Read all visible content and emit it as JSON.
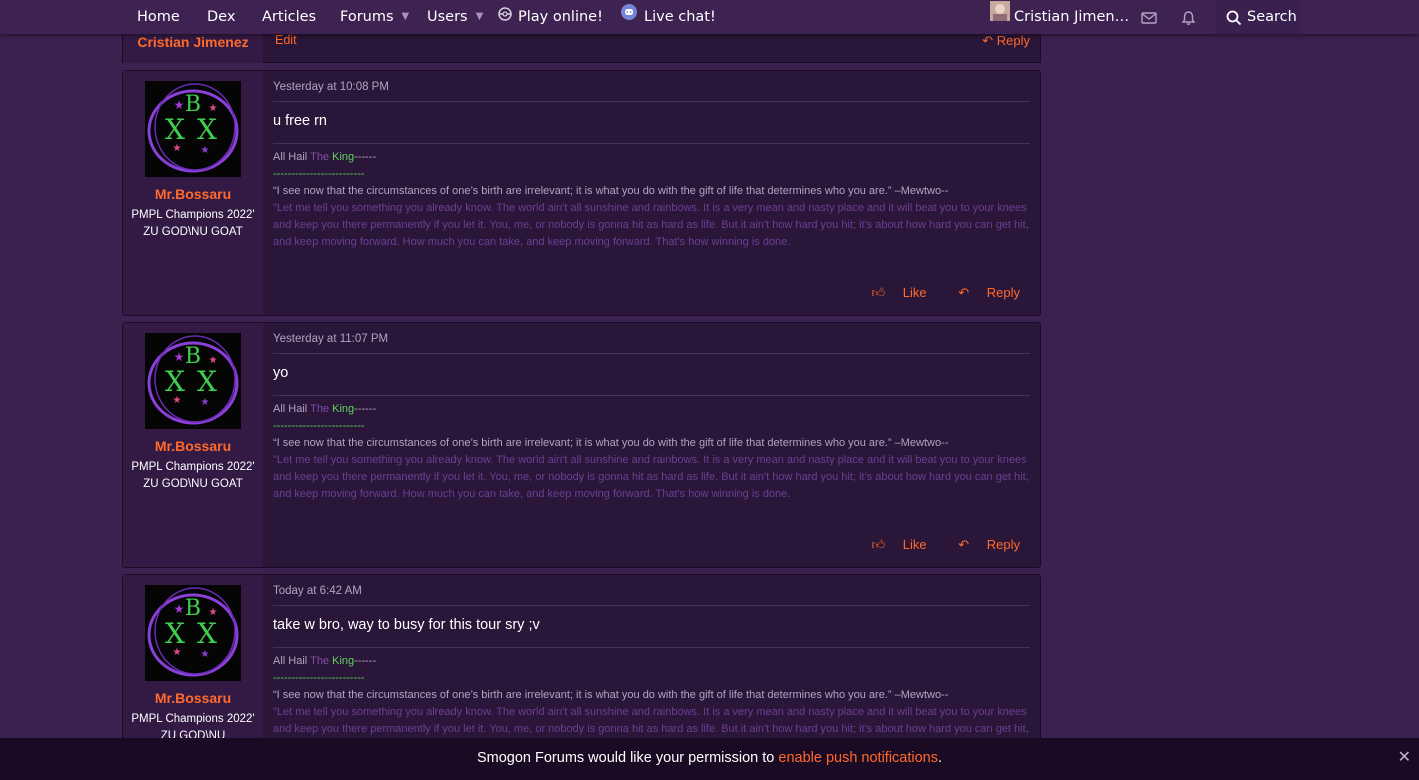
{
  "nav": {
    "home": "Home",
    "dex": "Dex",
    "articles": "Articles",
    "forums": "Forums",
    "users": "Users",
    "play_online": "Play online!",
    "live_chat": "Live chat!",
    "account_name": "Cristian Jimen…",
    "search": "Search"
  },
  "top_partial_post": {
    "username": "Cristian Jimenez",
    "edit": "Edit",
    "reply": "Reply"
  },
  "posts": [
    {
      "date": "Yesterday at 10:08 PM",
      "body": "u free rn",
      "username": "Mr.Bossaru",
      "user_title": "PMPL Champions 2022' ZU GOD\\NU GOAT",
      "like": "Like",
      "reply": "Reply"
    },
    {
      "date": "Yesterday at 11:07 PM",
      "body": "yo",
      "username": "Mr.Bossaru",
      "user_title": "PMPL Champions 2022' ZU GOD\\NU GOAT",
      "like": "Like",
      "reply": "Reply"
    },
    {
      "date": "Today at 6:42 AM",
      "body": "take w bro, way to busy for this tour sry ;v",
      "username": "Mr.Bossaru",
      "user_title": "PMPL Champions 2022' ZU GOD\\NU",
      "like": "",
      "reply": ""
    }
  ],
  "signature": {
    "all_hail": "All Hail ",
    "the": "The",
    "king": "King",
    "trail": "------",
    "dashes": "-------------------------",
    "quote1": "“I see now that the circumstances of one’s birth are irrelevant; it is what you do with the gift of life that determines who you are.” –Mewtwo--",
    "quote2": "\"Let me tell you something you already know. The world ain't all sunshine and rainbows. It is a very mean and nasty place and it will beat you to your knees and keep you there permanently if you let it. You, me, or nobody is gonna hit as hard as life. But it ain't how hard you hit; it's about how hard you can get hit, and keep moving forward. How much you can take, and keep moving forward. That's how winning is done."
  },
  "push_notification": {
    "text_before": "Smogon Forums would like your permission to ",
    "link": "enable push notifications",
    "text_after": ".",
    "close": "✕"
  },
  "colors": {
    "accent": "#ff6a2a",
    "page_bg": "#3b2150",
    "post_bg": "#2a1638"
  }
}
